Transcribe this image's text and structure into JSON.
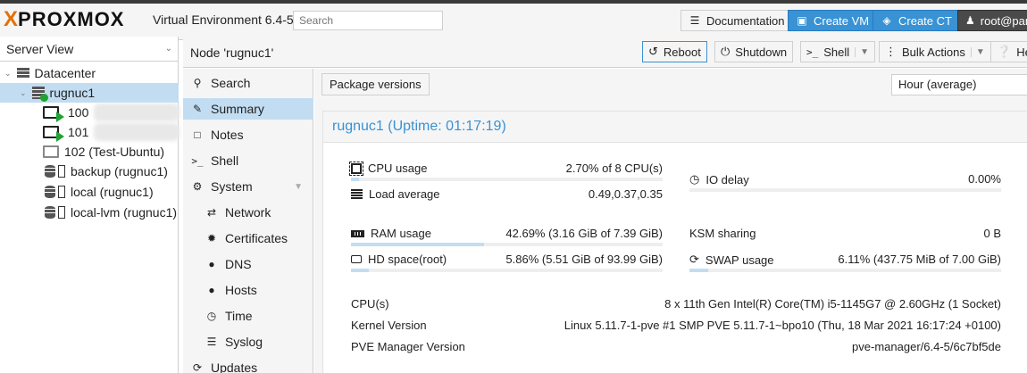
{
  "header": {
    "brand_x": "X",
    "brand_word": "PROXMOX",
    "version": "Virtual Environment 6.4-5",
    "search_placeholder": "Search",
    "documentation": "Documentation",
    "create_vm": "Create VM",
    "create_ct": "Create CT",
    "user": "root@pam"
  },
  "tree": {
    "view": "Server View",
    "items": [
      {
        "label": "Datacenter"
      },
      {
        "label": "rugnuc1"
      },
      {
        "label": "100"
      },
      {
        "label": "101"
      },
      {
        "label": "102 (Test-Ubuntu)"
      },
      {
        "label": "backup (rugnuc1)"
      },
      {
        "label": "local (rugnuc1)"
      },
      {
        "label": "local-lvm (rugnuc1)"
      }
    ]
  },
  "node_bar": {
    "title": "Node 'rugnuc1'",
    "reboot": "Reboot",
    "shutdown": "Shutdown",
    "shell": "Shell",
    "bulk": "Bulk Actions",
    "help": "Help"
  },
  "nav": [
    {
      "label": "Search",
      "icon": "search-icon"
    },
    {
      "label": "Summary",
      "icon": "book-icon"
    },
    {
      "label": "Notes",
      "icon": "note-icon"
    },
    {
      "label": "Shell",
      "icon": "terminal-icon"
    },
    {
      "label": "System",
      "icon": "gears-icon"
    },
    {
      "label": "Network",
      "icon": "network-icon"
    },
    {
      "label": "Certificates",
      "icon": "certificate-icon"
    },
    {
      "label": "DNS",
      "icon": "globe-icon"
    },
    {
      "label": "Hosts",
      "icon": "globe-icon"
    },
    {
      "label": "Time",
      "icon": "clock-icon"
    },
    {
      "label": "Syslog",
      "icon": "list-icon"
    },
    {
      "label": "Updates",
      "icon": "refresh-icon"
    }
  ],
  "content": {
    "package_versions": "Package versions",
    "timeframe": "Hour (average)",
    "panel_title": "rugnuc1 (Uptime: 01:17:19)",
    "stats": {
      "cpu": {
        "label": "CPU usage",
        "value": "2.70% of 8 CPU(s)",
        "fraction": 0.027
      },
      "load": {
        "label": "Load average",
        "value": "0.49,0.37,0.35"
      },
      "io": {
        "label": "IO delay",
        "value": "0.00%",
        "fraction": 0.0
      },
      "ram": {
        "label": "RAM usage",
        "value": "42.69% (3.16 GiB of 7.39 GiB)",
        "fraction": 0.4269
      },
      "ksm": {
        "label": "KSM sharing",
        "value": "0 B"
      },
      "hd": {
        "label": "HD space(root)",
        "value": "5.86% (5.51 GiB of 93.99 GiB)",
        "fraction": 0.0586
      },
      "swap": {
        "label": "SWAP usage",
        "value": "6.11% (437.75 MiB of 7.00 GiB)",
        "fraction": 0.0611
      }
    },
    "info": [
      {
        "k": "CPU(s)",
        "v": "8 x 11th Gen Intel(R) Core(TM) i5-1145G7 @ 2.60GHz (1 Socket)"
      },
      {
        "k": "Kernel Version",
        "v": "Linux 5.11.7-1-pve #1 SMP PVE 5.11.7-1~bpo10 (Thu, 18 Mar 2021 16:17:24 +0100)"
      },
      {
        "k": "PVE Manager Version",
        "v": "pve-manager/6.4-5/6c7bf5de"
      }
    ]
  },
  "colors": {
    "accent": "#3892d4",
    "selected": "#c2ddf2",
    "brand": "#e57000",
    "running": "#21a334"
  }
}
